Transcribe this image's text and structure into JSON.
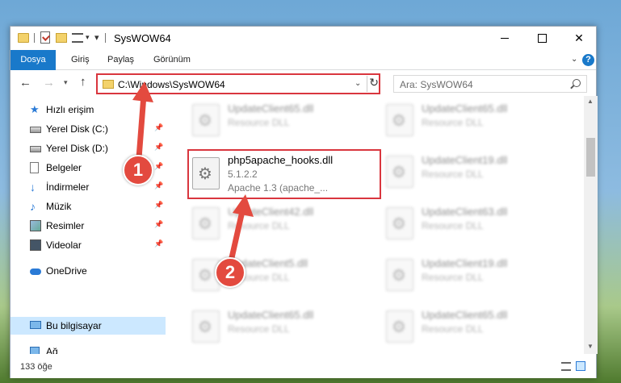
{
  "window": {
    "title": "SysWOW64",
    "min_glyph": "",
    "close_glyph": ""
  },
  "ribbon": {
    "tabs": [
      "Dosya",
      "Giriş",
      "Paylaş",
      "Görünüm"
    ],
    "help": "?"
  },
  "address": {
    "path": "C:\\Windows\\SysWOW64",
    "search_placeholder": "Ara: SysWOW64"
  },
  "nav": {
    "items": [
      {
        "label": "Hızlı erişim",
        "icon": "star-icon"
      },
      {
        "label": "Yerel Disk (C:)",
        "icon": "drive-icon",
        "pinned": true
      },
      {
        "label": "Yerel Disk (D:)",
        "icon": "drive-icon",
        "pinned": true
      },
      {
        "label": "Belgeler",
        "icon": "documents-icon",
        "pinned": true
      },
      {
        "label": "İndirmeler",
        "icon": "download-icon",
        "pinned": true
      },
      {
        "label": "Müzik",
        "icon": "music-icon",
        "pinned": true
      },
      {
        "label": "Resimler",
        "icon": "pictures-icon",
        "pinned": true
      },
      {
        "label": "Videolar",
        "icon": "videos-icon",
        "pinned": true
      },
      {
        "label": "OneDrive",
        "icon": "onedrive-icon"
      },
      {
        "label": "Bu bilgisayar",
        "icon": "computer-icon",
        "selected": true
      },
      {
        "label": "Ağ",
        "icon": "network-icon"
      }
    ],
    "pin_glyph": "📌"
  },
  "files": {
    "selected": {
      "name": "php5apache_hooks.dll",
      "version": "5.1.2.2",
      "description": "Apache 1.3 (apache_..."
    },
    "blurred": [
      {
        "name": "UpdateClient65.dll",
        "desc": "Resource DLL"
      },
      {
        "name": "UpdateClient65.dll",
        "desc": "Resource DLL"
      },
      {
        "name": "UpdateClient19.dll",
        "desc": "Resource DLL"
      },
      {
        "name": "UpdateClient42.dll",
        "desc": "Resource DLL"
      },
      {
        "name": "UpdateClient63.dll",
        "desc": "Resource DLL"
      },
      {
        "name": "UpdateClient5.dll",
        "desc": "Resource DLL"
      },
      {
        "name": "UpdateClient19.dll",
        "desc": "Resource DLL"
      },
      {
        "name": "UpdateClient65.dll",
        "desc": "Resource DLL"
      },
      {
        "name": "UpdateClient65.dll",
        "desc": "Resource DLL"
      }
    ]
  },
  "status": {
    "count": "133 öğe"
  },
  "annotations": {
    "badge1": "1",
    "badge2": "2",
    "color": "#e34a3f"
  }
}
